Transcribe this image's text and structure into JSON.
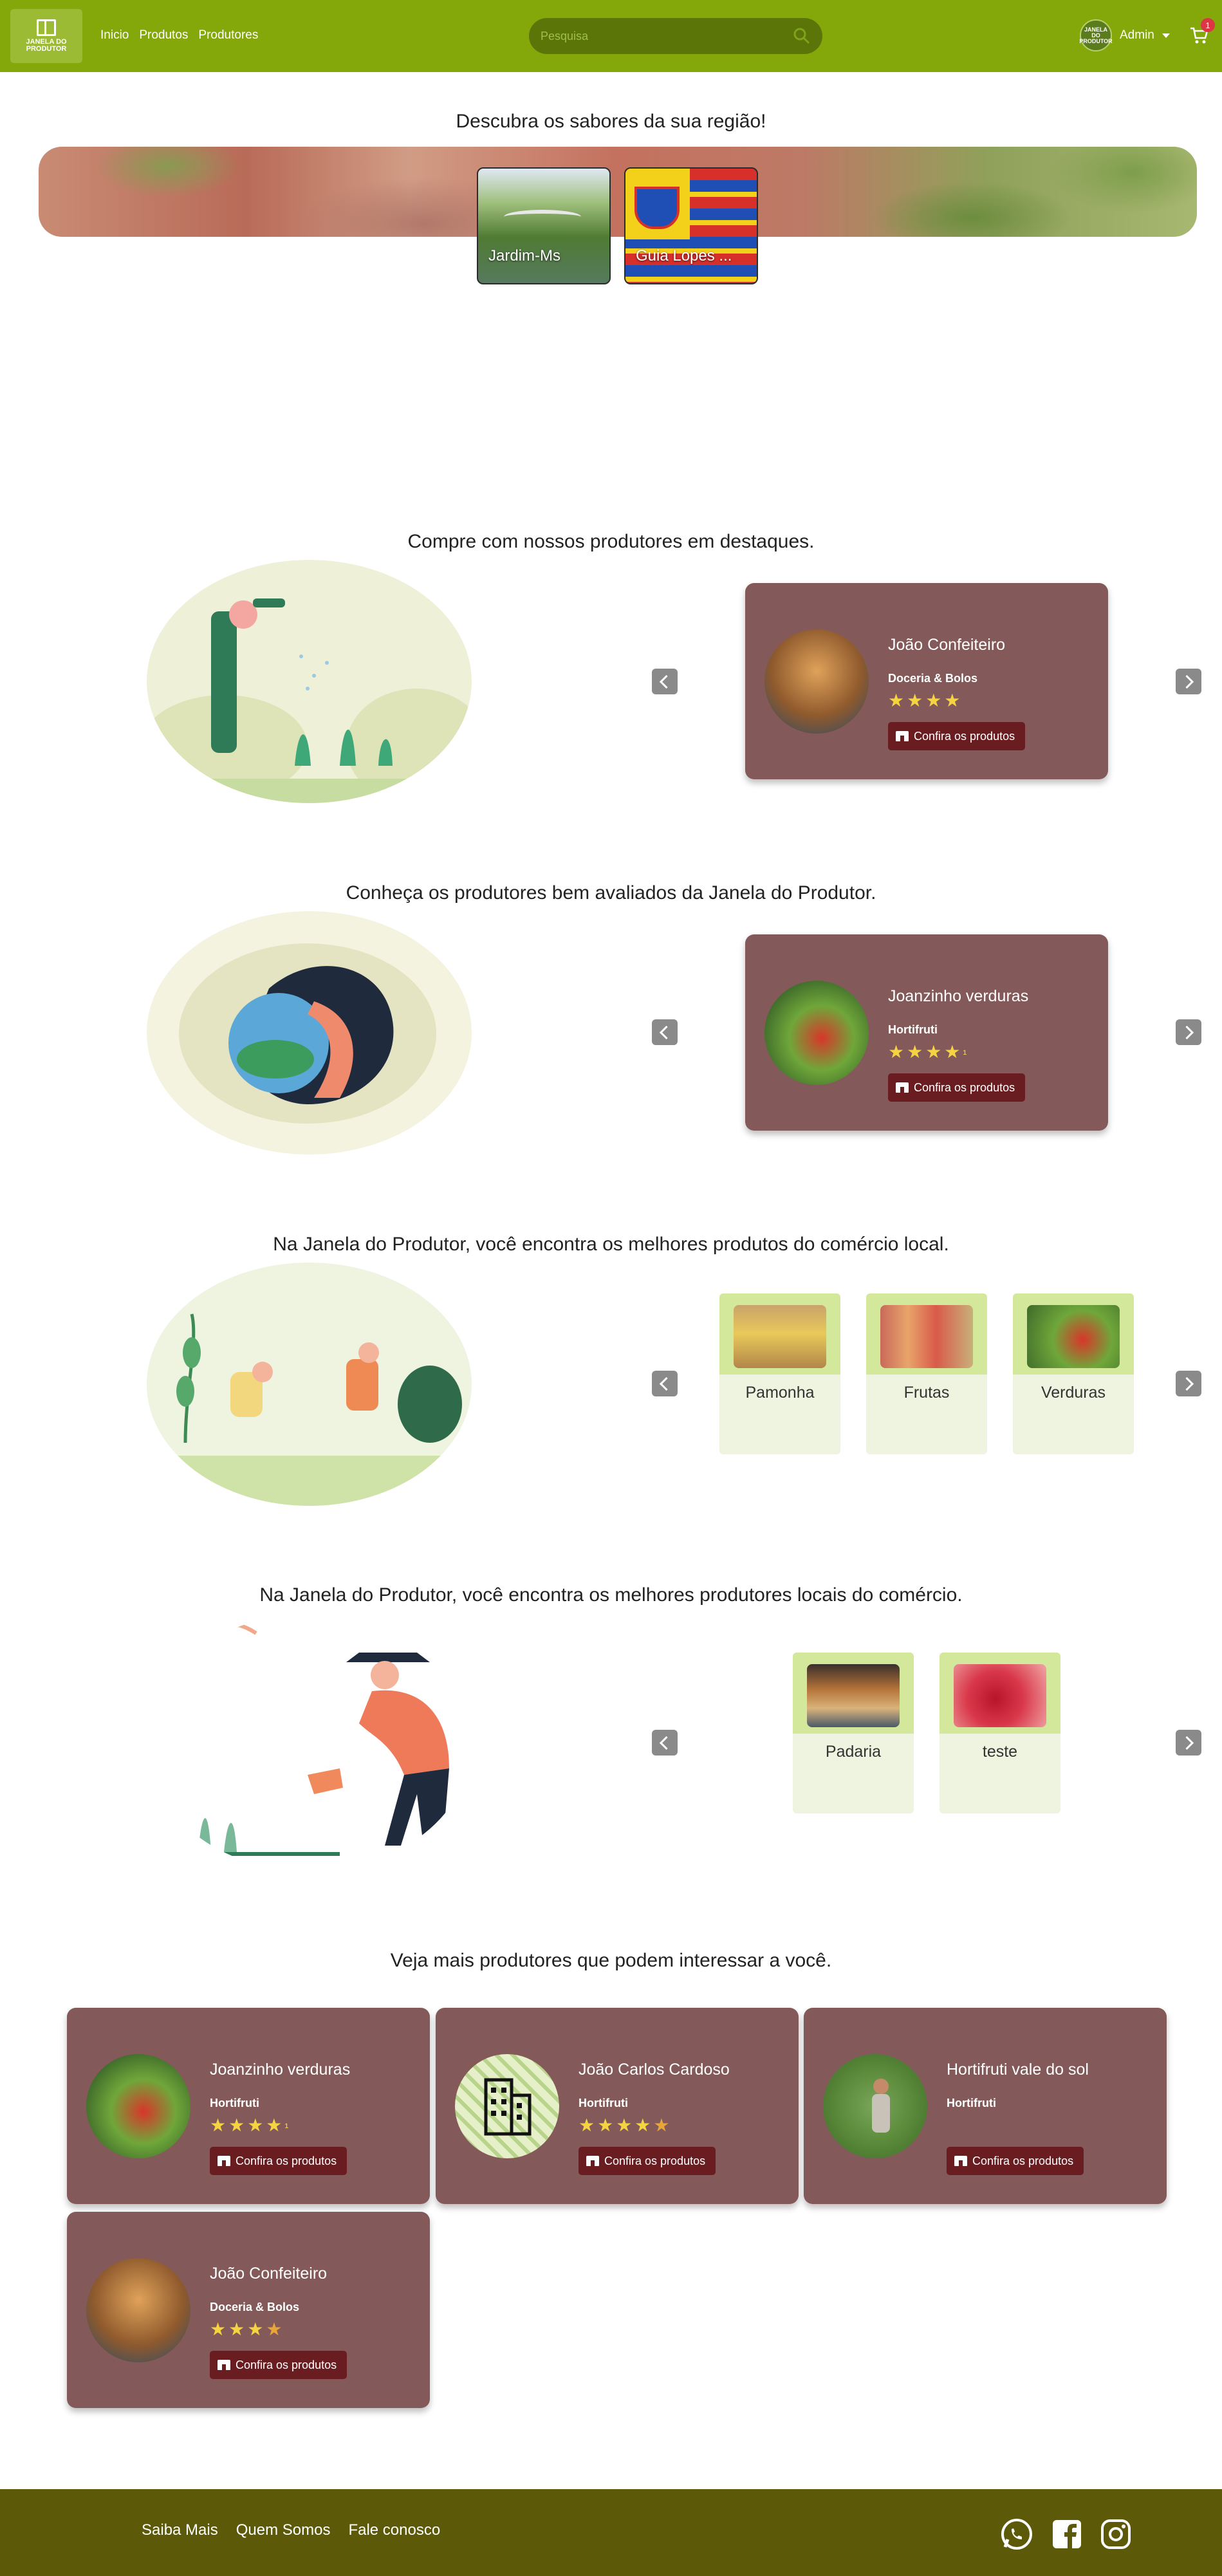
{
  "header": {
    "logo_line1": "JANELA DO",
    "logo_line2": "PRODUTOR",
    "nav": [
      {
        "label": "Inicio"
      },
      {
        "label": "Produtos"
      },
      {
        "label": "Produtores"
      }
    ],
    "search_placeholder": "Pesquisa",
    "user": {
      "name": "Admin",
      "avatar_text": "JANELA DO PRODUTOR"
    },
    "cart_count": "1",
    "brand_color": "#84a80a"
  },
  "hero": {
    "title": "Descubra os sabores da sua região!",
    "cities": [
      {
        "label": "Jardim-Ms"
      },
      {
        "label": "Guia Lopes ..."
      }
    ]
  },
  "sections": {
    "featured": {
      "title": "Compre com nossos produtores em destaques.",
      "card": {
        "name": "João Confeiteiro",
        "category": "Doceria & Bolos",
        "stars": "★★★★",
        "button": "Confira os produtos"
      }
    },
    "top_rated": {
      "title": "Conheça os produtores bem avaliados da Janela do Produtor.",
      "card": {
        "name": "Joanzinho verduras",
        "category": "Hortifruti",
        "stars": "★★★★",
        "half": "¹",
        "button": "Confira os produtos"
      }
    },
    "products": {
      "title": "Na Janela do Produtor, você encontra os melhores produtos do comércio local.",
      "items": [
        {
          "label": "Pamonha"
        },
        {
          "label": "Frutas"
        },
        {
          "label": "Verduras"
        }
      ]
    },
    "producer_categories": {
      "title": "Na Janela do Produtor, você encontra os melhores produtores locais do comércio.",
      "items": [
        {
          "label": "Padaria"
        },
        {
          "label": "teste"
        }
      ]
    },
    "more": {
      "title": "Veja mais produtores que podem interessar a você.",
      "cards": [
        {
          "name": "Joanzinho verduras",
          "category": "Hortifruti",
          "stars": "★★★★",
          "half": "¹",
          "button": "Confira os produtos"
        },
        {
          "name": "João Carlos Cardoso",
          "category": "Hortifruti",
          "stars": "★★★★",
          "half": "★",
          "button": "Confira os produtos"
        },
        {
          "name": "Hortifruti vale do sol",
          "category": "Hortifruti",
          "stars": "",
          "half": "",
          "button": "Confira os produtos"
        },
        {
          "name": "João Confeiteiro",
          "category": "Doceria & Bolos",
          "stars": "★★★",
          "half": "★",
          "button": "Confira os produtos"
        }
      ]
    }
  },
  "footer": {
    "links": [
      {
        "label": "Saiba Mais"
      },
      {
        "label": "Quem Somos"
      },
      {
        "label": "Fale conosco"
      }
    ],
    "social": [
      "whatsapp-icon",
      "facebook-icon",
      "instagram-icon"
    ]
  }
}
